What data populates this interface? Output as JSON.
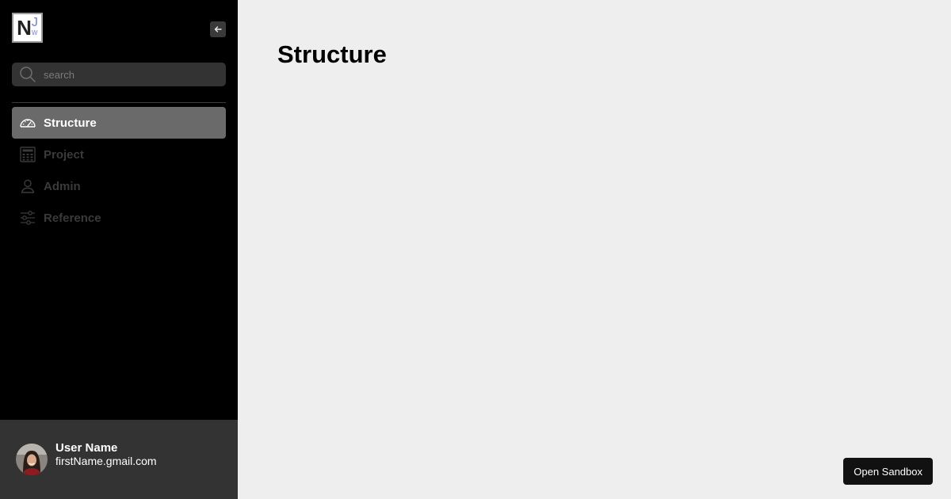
{
  "app": {
    "logo_primary": "N",
    "logo_secondary": "J",
    "logo_tertiary": "W"
  },
  "sidebar": {
    "collapse_icon": "arrow-left-icon",
    "search": {
      "placeholder": "search",
      "value": "",
      "icon": "search-icon"
    },
    "items": [
      {
        "label": "Structure",
        "icon": "dashboard-gauge-icon",
        "active": true
      },
      {
        "label": "Project",
        "icon": "calculator-icon",
        "active": false
      },
      {
        "label": "Admin",
        "icon": "user-icon",
        "active": false
      },
      {
        "label": "Reference",
        "icon": "sliders-icon",
        "active": false
      }
    ]
  },
  "user": {
    "name": "User Name",
    "email": "firstName.gmail.com"
  },
  "main": {
    "title": "Structure",
    "sandbox_label": "Open Sandbox"
  },
  "colors": {
    "sidebar_bg": "#000000",
    "active_item_bg": "#6a6a6a",
    "main_bg": "#eeeeee",
    "logo_accent": "#6b7fd7"
  }
}
